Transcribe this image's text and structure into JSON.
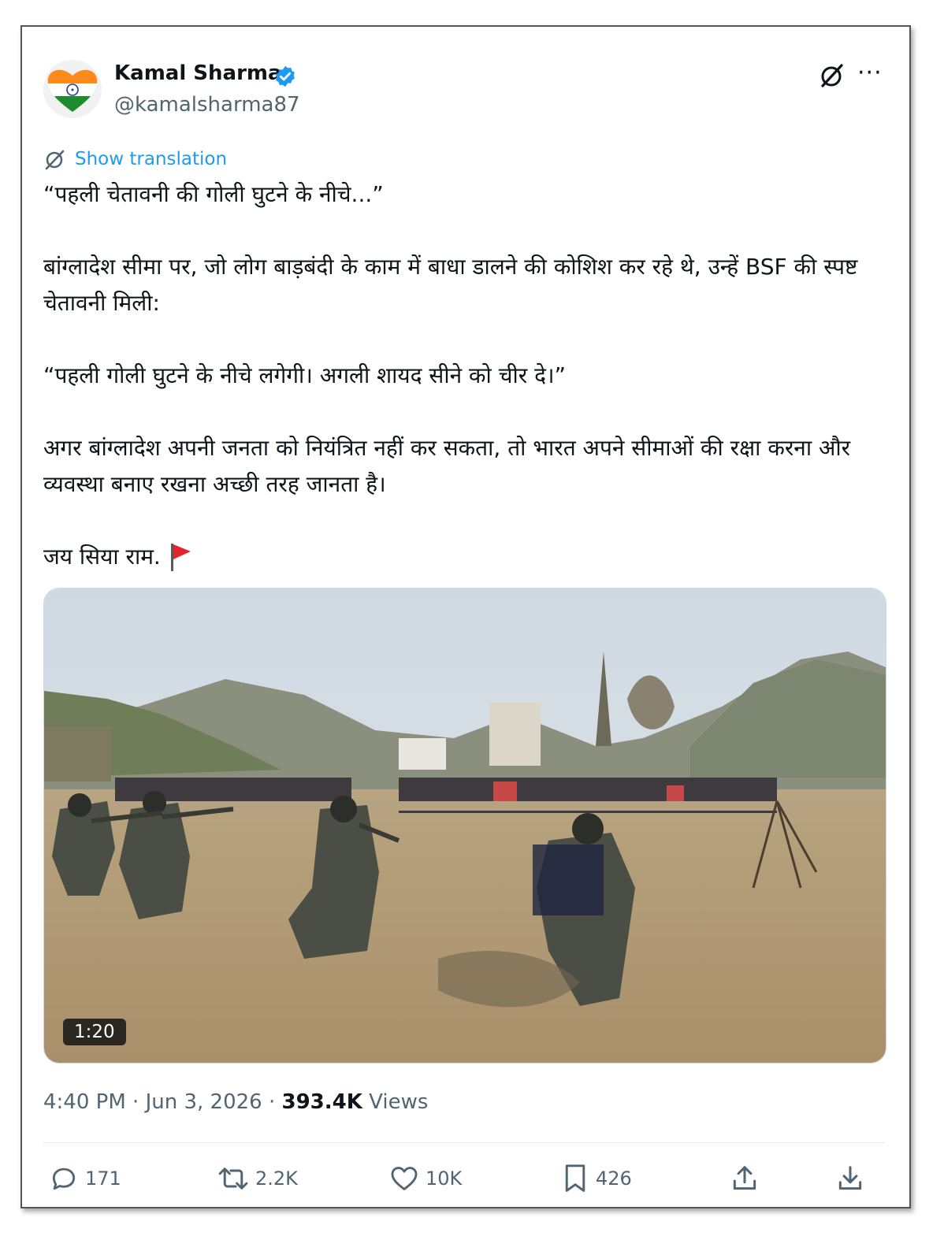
{
  "author": {
    "name": "Kamal Sharma",
    "handle": "@kamalsharma87",
    "avatar_icon": "india-flag-heart-avatar",
    "verified_color": "#1d9bf0"
  },
  "header": {
    "grok_icon": "grok-icon",
    "more_label": "···"
  },
  "translation": {
    "label": "Show translation",
    "icon": "translate-icon"
  },
  "tweet": {
    "p1": "“पहली चेतावनी की गोली घुटने के नीचे...”",
    "p2": "बांग्लादेश सीमा पर, जो लोग बाड़बंदी के काम में बाधा डालने की कोशिश कर रहे थे, उन्हें BSF की स्पष्ट चेतावनी मिली:",
    "p3": "“पहली गोली घुटने के नीचे लगेगी। अगली शायद सीने को चीर दे।”",
    "p4": "अगर बांग्लादेश अपनी जनता को नियंत्रित नहीं कर सकता, तो भारत अपने सीमाओं की रक्षा करना और व्यवस्था बनाए रखना अच्छी तरह जानता है।",
    "p5": "जय सिया राम.",
    "flag_icon": "red-flag-icon"
  },
  "media": {
    "duration": "1:20"
  },
  "meta": {
    "time": "4:40 PM",
    "sep": "·",
    "date": "Jun 3, 2026",
    "views_count": "393.4K",
    "views_label": "Views"
  },
  "actions": {
    "replies": "171",
    "reposts": "2.2K",
    "likes": "10K",
    "bookmarks": "426"
  },
  "colors": {
    "text": "#0f1419",
    "secondary": "#536471",
    "accent": "#1d9bf0"
  }
}
